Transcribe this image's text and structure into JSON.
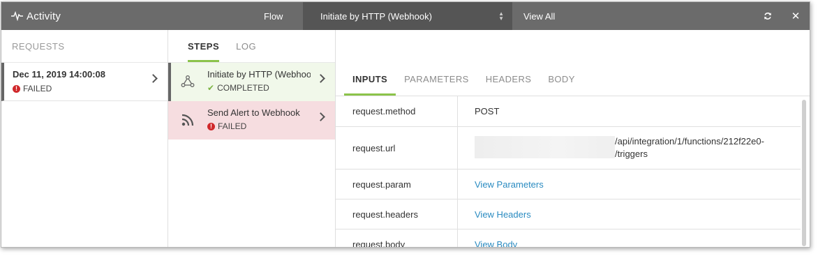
{
  "header": {
    "title": "Activity",
    "flow_label": "Flow",
    "flow_value": "Initiate by HTTP (Webhook)",
    "view_all": "View All"
  },
  "requests": {
    "heading": "REQUESTS",
    "items": [
      {
        "date": "Dec 11, 2019 14:00:08",
        "status": "FAILED"
      }
    ]
  },
  "steps": {
    "tabs": [
      "STEPS",
      "LOG"
    ],
    "items": [
      {
        "title": "Initiate by HTTP (Webhook)",
        "status": "COMPLETED"
      },
      {
        "title": "Send Alert to Webhook",
        "status": "FAILED"
      }
    ]
  },
  "details": {
    "tabs": [
      "INPUTS",
      "PARAMETERS",
      "HEADERS",
      "BODY"
    ],
    "rows": [
      {
        "key": "request.method",
        "value": "POST"
      },
      {
        "key": "request.url",
        "value_line1": "/api/integration/1/functions/212f22e0-",
        "value_line2": "/triggers"
      },
      {
        "key": "request.param",
        "value": "View Parameters"
      },
      {
        "key": "request.headers",
        "value": "View Headers"
      },
      {
        "key": "request.body",
        "value": "View Body"
      }
    ]
  },
  "colors": {
    "accent": "#8bc34a",
    "header_bg": "#6b6b6b",
    "link": "#2a8bc1",
    "error": "#d0282b",
    "completed_bg": "#f1f8ea",
    "failed_bg": "#f6dde0"
  }
}
